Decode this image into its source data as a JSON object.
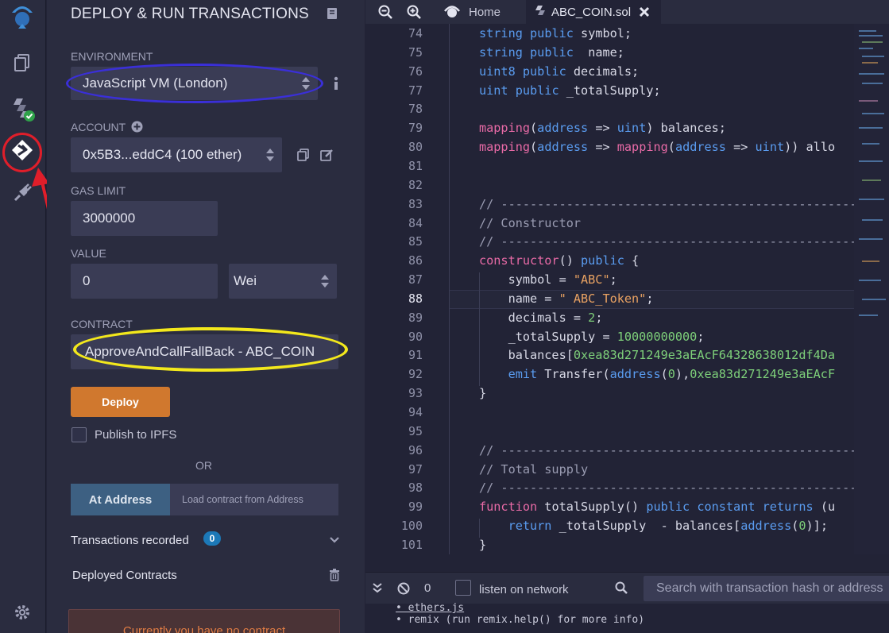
{
  "colors": {
    "accent_orange": "#d0782e",
    "accent_blue": "#3d6082",
    "badge_blue": "#1c79b8",
    "annotation_red": "#e01e2a",
    "annotation_blue": "#3a2fd8",
    "annotation_yellow": "#f3e81c"
  },
  "rail": {
    "icons": [
      "remix-logo-icon",
      "file-explorer-icon",
      "solidity-compiler-icon",
      "deploy-run-icon",
      "plugin-manager-icon",
      "settings-icon"
    ]
  },
  "panel": {
    "title": "DEPLOY & RUN TRANSACTIONS",
    "environment": {
      "label": "ENVIRONMENT",
      "value": "JavaScript VM (London)"
    },
    "account": {
      "label": "ACCOUNT",
      "value": "0x5B3...eddC4 (100 ether)"
    },
    "gas_limit": {
      "label": "GAS LIMIT",
      "value": "3000000"
    },
    "value": {
      "label": "VALUE",
      "amount": "0",
      "unit": "Wei"
    },
    "contract": {
      "label": "CONTRACT",
      "value": "ApproveAndCallFallBack - ABC_COIN"
    },
    "deploy_label": "Deploy",
    "publish_label": "Publish to IPFS",
    "or_label": "OR",
    "at_address_label": "At Address",
    "at_address_placeholder": "Load contract from Address",
    "transactions_label": "Transactions recorded",
    "transactions_count": "0",
    "deployed_label": "Deployed Contracts",
    "no_contract_text": "Currently you have no contract"
  },
  "tabs": {
    "home": "Home",
    "file": "ABC_COIN.sol"
  },
  "editor": {
    "current_line": "88",
    "lines": [
      {
        "n": "74",
        "t": "string public symbol;"
      },
      {
        "n": "75",
        "t": "string public  name;"
      },
      {
        "n": "76",
        "t": "uint8 public decimals;"
      },
      {
        "n": "77",
        "t": "uint public _totalSupply;"
      },
      {
        "n": "78",
        "t": ""
      },
      {
        "n": "79",
        "t": "mapping(address => uint) balances;"
      },
      {
        "n": "80",
        "t": "mapping(address => mapping(address => uint)) allo"
      },
      {
        "n": "81",
        "t": ""
      },
      {
        "n": "82",
        "t": ""
      },
      {
        "n": "83",
        "t": "// ----------------------------------------------------"
      },
      {
        "n": "84",
        "t": "// Constructor"
      },
      {
        "n": "85",
        "t": "// ----------------------------------------------------"
      },
      {
        "n": "86",
        "t": "constructor() public {"
      },
      {
        "n": "87",
        "t": "    symbol = \"ABC\";"
      },
      {
        "n": "88",
        "t": "    name = \" ABC_Token\";"
      },
      {
        "n": "89",
        "t": "    decimals = 2;"
      },
      {
        "n": "90",
        "t": "    _totalSupply = 10000000000;"
      },
      {
        "n": "91",
        "t": "    balances[0xea83d271249e3aEAcF64328638012df4Da"
      },
      {
        "n": "92",
        "t": "    emit Transfer(address(0),0xea83d271249e3aEAcF"
      },
      {
        "n": "93",
        "t": "}"
      },
      {
        "n": "94",
        "t": ""
      },
      {
        "n": "95",
        "t": ""
      },
      {
        "n": "96",
        "t": "// ----------------------------------------------------"
      },
      {
        "n": "97",
        "t": "// Total supply"
      },
      {
        "n": "98",
        "t": "// ----------------------------------------------------"
      },
      {
        "n": "99",
        "t": "function totalSupply() public constant returns (u"
      },
      {
        "n": "100",
        "t": "    return _totalSupply  - balances[address(0)];"
      },
      {
        "n": "101",
        "t": "}"
      }
    ]
  },
  "terminal": {
    "pending_count": "0",
    "listen_label": "listen on network",
    "search_placeholder": "Search with transaction hash or address",
    "output": [
      "• ethers.js",
      "• remix (run remix.help() for more info)"
    ]
  }
}
